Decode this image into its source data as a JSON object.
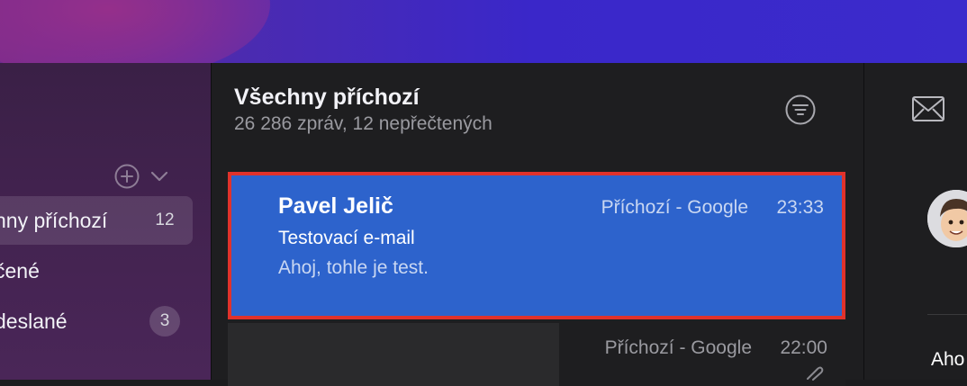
{
  "sidebar": {
    "items": [
      {
        "label": "nny příchozí",
        "badge": "12"
      },
      {
        "label": "čené",
        "badge": ""
      },
      {
        "label": "deslané",
        "badge": "3"
      }
    ]
  },
  "list": {
    "title": "Všechny příchozí",
    "subtitle": "26 286 zpráv, 12 nepřečtených",
    "messages": [
      {
        "from": "Pavel Jelič",
        "mailbox": "Příchozí - Google",
        "time": "23:33",
        "subject": "Testovací e-mail",
        "preview": "Ahoj, tohle je test."
      },
      {
        "mailbox": "Příchozí - Google",
        "time": "22:00"
      }
    ]
  },
  "detail": {
    "text": "Aho"
  },
  "colors": {
    "selection": "#2d63cc",
    "highlight_border": "#e0322b"
  },
  "icons": {
    "add": "plus-circle-icon",
    "chevron": "chevron-down-icon",
    "filter": "filter-icon",
    "envelope": "envelope-icon",
    "attachment": "paperclip-icon"
  }
}
